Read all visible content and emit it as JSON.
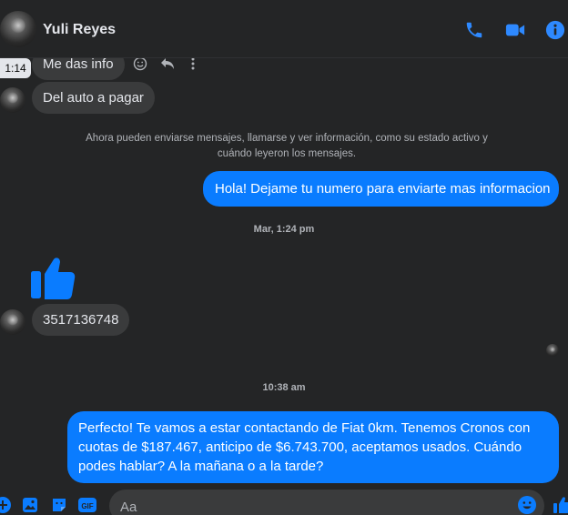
{
  "header": {
    "contact_name": "Yuli Reyes",
    "icons": {
      "call": "phone-icon",
      "video": "video-camera-icon",
      "info": "info-icon"
    }
  },
  "messages": {
    "hover_time": "1:14",
    "received_1": "Me das info",
    "received_2": "Del auto a pagar",
    "system_note": "Ahora pueden enviarse mensajes, llamarse y ver información, como su estado activo y cuándo leyeron los mensajes.",
    "sent_1": "Hola! Dejame tu numero para enviarte mas informacion",
    "timestamp_1": "Mar, 1:24 pm",
    "received_like": "thumbs-up",
    "received_3": "3517136748",
    "timestamp_2": "10:38 am",
    "sent_2": "Perfecto! Te vamos a estar contactando de Fiat 0km. Tenemos Cronos con cuotas de $187.467, anticipo de $6.743.700, aceptamos usados. Cuándo podes hablar? A la mañana o a la tarde?"
  },
  "composer": {
    "placeholder": "Aa"
  },
  "colors": {
    "background": "#242526",
    "bubble_incoming": "#3a3b3c",
    "bubble_outgoing": "#0a7cff",
    "accent": "#2e89ff"
  }
}
